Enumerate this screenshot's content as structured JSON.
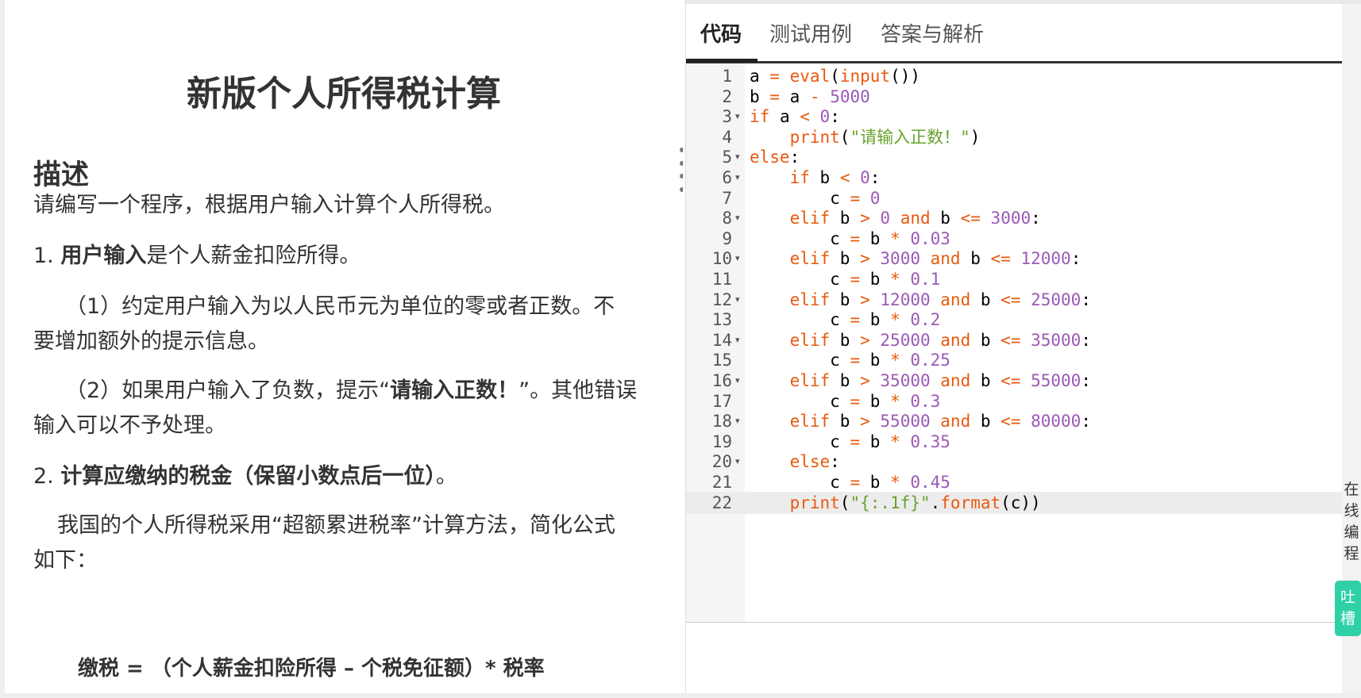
{
  "problem": {
    "title": "新版个人所得税计算",
    "section_heading": "描述",
    "intro": "请编写一个程序，根据用户输入计算个人所得税。",
    "point1_prefix": "1. ",
    "point1_bold": "用户输入",
    "point1_rest": "是个人薪金扣险所得。",
    "sub1_line1": "（1）约定用户输入为以人民币元为单位的零或者正数。不",
    "sub1_line2": "要增加额外的提示信息。",
    "sub2_line1_pre": "（2）如果用户输入了负数，提示“",
    "sub2_line1_bold": "请输入正数！",
    "sub2_line1_post": "”。其他错误",
    "sub2_line2": "输入可以不予处理。",
    "point2_prefix": "2. ",
    "point2_bold": "计算应缴纳的税金（保留小数点后一位）",
    "point2_post": "。",
    "method_line1": "我国的个人所得税采用“超额累进税率”计算方法，简化公式",
    "method_line2": "如下：",
    "formula": "缴税 = （个人薪金扣险所得 – 个税免征额）* 税率"
  },
  "tabs": [
    {
      "label": "代码",
      "active": true
    },
    {
      "label": "测试用例",
      "active": false
    },
    {
      "label": "答案与解析",
      "active": false
    }
  ],
  "editor": {
    "active_line": 22,
    "lines": [
      {
        "num": "1",
        "fold": false,
        "code": "a = eval(input())"
      },
      {
        "num": "2",
        "fold": false,
        "code": "b = a - 5000"
      },
      {
        "num": "3",
        "fold": true,
        "code": "if a < 0:"
      },
      {
        "num": "4",
        "fold": false,
        "code": "    print(\"请输入正数！\")"
      },
      {
        "num": "5",
        "fold": true,
        "code": "else:"
      },
      {
        "num": "6",
        "fold": true,
        "code": "    if b < 0:"
      },
      {
        "num": "7",
        "fold": false,
        "code": "        c = 0"
      },
      {
        "num": "8",
        "fold": true,
        "code": "    elif b > 0 and b <= 3000:"
      },
      {
        "num": "9",
        "fold": false,
        "code": "        c = b * 0.03"
      },
      {
        "num": "10",
        "fold": true,
        "code": "    elif b > 3000 and b <= 12000:"
      },
      {
        "num": "11",
        "fold": false,
        "code": "        c = b * 0.1"
      },
      {
        "num": "12",
        "fold": true,
        "code": "    elif b > 12000 and b <= 25000:"
      },
      {
        "num": "13",
        "fold": false,
        "code": "        c = b * 0.2"
      },
      {
        "num": "14",
        "fold": true,
        "code": "    elif b > 25000 and b <= 35000:"
      },
      {
        "num": "15",
        "fold": false,
        "code": "        c = b * 0.25"
      },
      {
        "num": "16",
        "fold": true,
        "code": "    elif b > 35000 and b <= 55000:"
      },
      {
        "num": "17",
        "fold": false,
        "code": "        c = b * 0.3"
      },
      {
        "num": "18",
        "fold": true,
        "code": "    elif b > 55000 and b <= 80000:"
      },
      {
        "num": "19",
        "fold": false,
        "code": "        c = b * 0.35"
      },
      {
        "num": "20",
        "fold": true,
        "code": "    else:"
      },
      {
        "num": "21",
        "fold": false,
        "code": "        c = b * 0.45"
      },
      {
        "num": "22",
        "fold": false,
        "code": "    print(\"{:.1f}\".format(c))"
      }
    ]
  },
  "side": {
    "online_label": "在线编程",
    "feedback_label": "吐槽"
  },
  "colors": {
    "keyword": "#e8590c",
    "number": "#9b59b6",
    "string": "#67a32b",
    "builtin": "#e8590c",
    "accent": "#2fd0a6"
  }
}
